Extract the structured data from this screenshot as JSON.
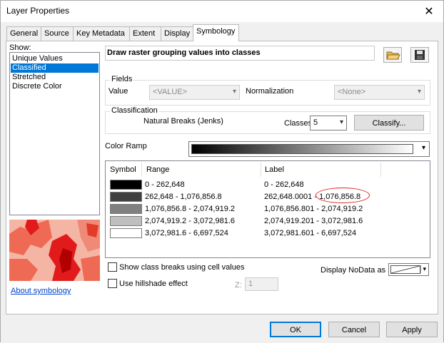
{
  "window": {
    "title": "Layer Properties"
  },
  "tabs": [
    "General",
    "Source",
    "Key Metadata",
    "Extent",
    "Display",
    "Symbology"
  ],
  "show": {
    "label": "Show:",
    "items": [
      "Unique Values",
      "Classified",
      "Stretched",
      "Discrete Color"
    ],
    "selected": "Classified"
  },
  "about_link": "About symbology",
  "heading": "Draw raster grouping values into classes",
  "fields": {
    "title": "Fields",
    "value_label": "Value",
    "value": "<VALUE>",
    "normalization_label": "Normalization",
    "normalization": "<None>"
  },
  "classification": {
    "title": "Classification",
    "method": "Natural Breaks (Jenks)",
    "classes_label": "Classes",
    "classes": "5",
    "classify_button": "Classify..."
  },
  "color_ramp": {
    "label": "Color Ramp"
  },
  "table": {
    "headers": {
      "symbol": "Symbol",
      "range": "Range",
      "label": "Label"
    },
    "rows": [
      {
        "color": "#000000",
        "range": "0 - 262,648",
        "label": "0 - 262,648"
      },
      {
        "color": "#404040",
        "range": "262,648 - 1,076,856.8",
        "label": "262,648.0001 - 1,076,856.8"
      },
      {
        "color": "#808080",
        "range": "1,076,856.8 - 2,074,919.2",
        "label": "1,076,856.801 - 2,074,919.2"
      },
      {
        "color": "#bfbfbf",
        "range": "2,074,919.2 - 3,072,981.6",
        "label": "2,074,919.201 - 3,072,981.6"
      },
      {
        "color": "#ffffff",
        "range": "3,072,981.6 - 6,697,524",
        "label": "3,072,981.601 - 6,697,524"
      }
    ]
  },
  "options": {
    "class_breaks": "Show class breaks using cell values",
    "hillshade": "Use hillshade effect",
    "z_label": "Z:",
    "z_value": "1",
    "nodata_label": "Display NoData as"
  },
  "footer": {
    "ok": "OK",
    "cancel": "Cancel",
    "apply": "Apply"
  },
  "colors": {
    "accent": "#0078d7",
    "annotation": "#e02020"
  }
}
